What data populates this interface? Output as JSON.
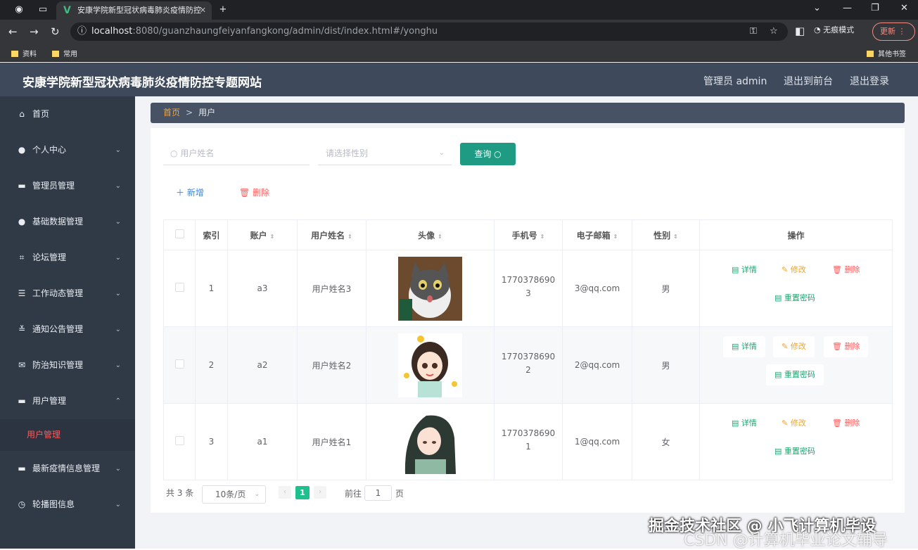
{
  "browser": {
    "tab_title": "安康学院新型冠状病毒肺炎疫情防控",
    "url_host": "localhost",
    "url_rest": ":8080/guanzhaungfeiyanfangkong/admin/dist/index.html#/yonghu",
    "incognito_label": "无痕模式",
    "update_label": "更新",
    "bookmarks": [
      "资料",
      "常用"
    ],
    "other_bookmarks": "其他书签"
  },
  "header": {
    "site_title": "安康学院新型冠状病毒肺炎疫情防控专题网站",
    "admin_label": "管理员 admin",
    "to_front_label": "退出到前台",
    "logout_label": "退出登录"
  },
  "sidebar": {
    "items": [
      {
        "label": "首页",
        "icon": "home-icon"
      },
      {
        "label": "个人中心",
        "icon": "user-icon"
      },
      {
        "label": "管理员管理",
        "icon": "chat-icon"
      },
      {
        "label": "基础数据管理",
        "icon": "user-icon"
      },
      {
        "label": "论坛管理",
        "icon": "crop-icon"
      },
      {
        "label": "工作动态管理",
        "icon": "list-icon"
      },
      {
        "label": "通知公告管理",
        "icon": "sliders-icon"
      },
      {
        "label": "防治知识管理",
        "icon": "mail-icon"
      },
      {
        "label": "用户管理",
        "icon": "monitor-icon"
      },
      {
        "label": "最新疫情信息管理",
        "icon": "monitor-icon"
      },
      {
        "label": "轮播图信息",
        "icon": "clock-icon"
      }
    ],
    "active_sub": "用户管理"
  },
  "breadcrumb": {
    "home": "首页",
    "separator": ">",
    "current": "用户"
  },
  "search": {
    "name_placeholder": "用户姓名",
    "gender_placeholder": "请选择性别",
    "query_label": "查询"
  },
  "actions": {
    "add_label": "新增",
    "delete_label": "删除"
  },
  "table": {
    "headers": [
      "索引",
      "账户",
      "用户姓名",
      "头像",
      "手机号",
      "电子邮箱",
      "性别",
      "操作"
    ],
    "rows": [
      {
        "index": "1",
        "account": "a3",
        "name": "用户姓名3",
        "phone_a": "1770378690",
        "phone_b": "3",
        "email": "3@qq.com",
        "gender": "男"
      },
      {
        "index": "2",
        "account": "a2",
        "name": "用户姓名2",
        "phone_a": "1770378690",
        "phone_b": "2",
        "email": "2@qq.com",
        "gender": "男"
      },
      {
        "index": "3",
        "account": "a1",
        "name": "用户姓名1",
        "phone_a": "1770378690",
        "phone_b": "1",
        "email": "1@qq.com",
        "gender": "女"
      }
    ],
    "op_labels": {
      "detail": "详情",
      "edit": "修改",
      "delete": "删除",
      "reset_pw": "重置密码"
    }
  },
  "pagination": {
    "total_label": "共 3 条",
    "page_size": "10条/页",
    "current_page": "1",
    "goto_label": "前往",
    "goto_value": "1",
    "page_unit": "页"
  },
  "watermark": {
    "line1": "掘金技术社区 @ 小飞计算机毕设",
    "line2": "CSDN @计算机毕业论文辅导"
  }
}
